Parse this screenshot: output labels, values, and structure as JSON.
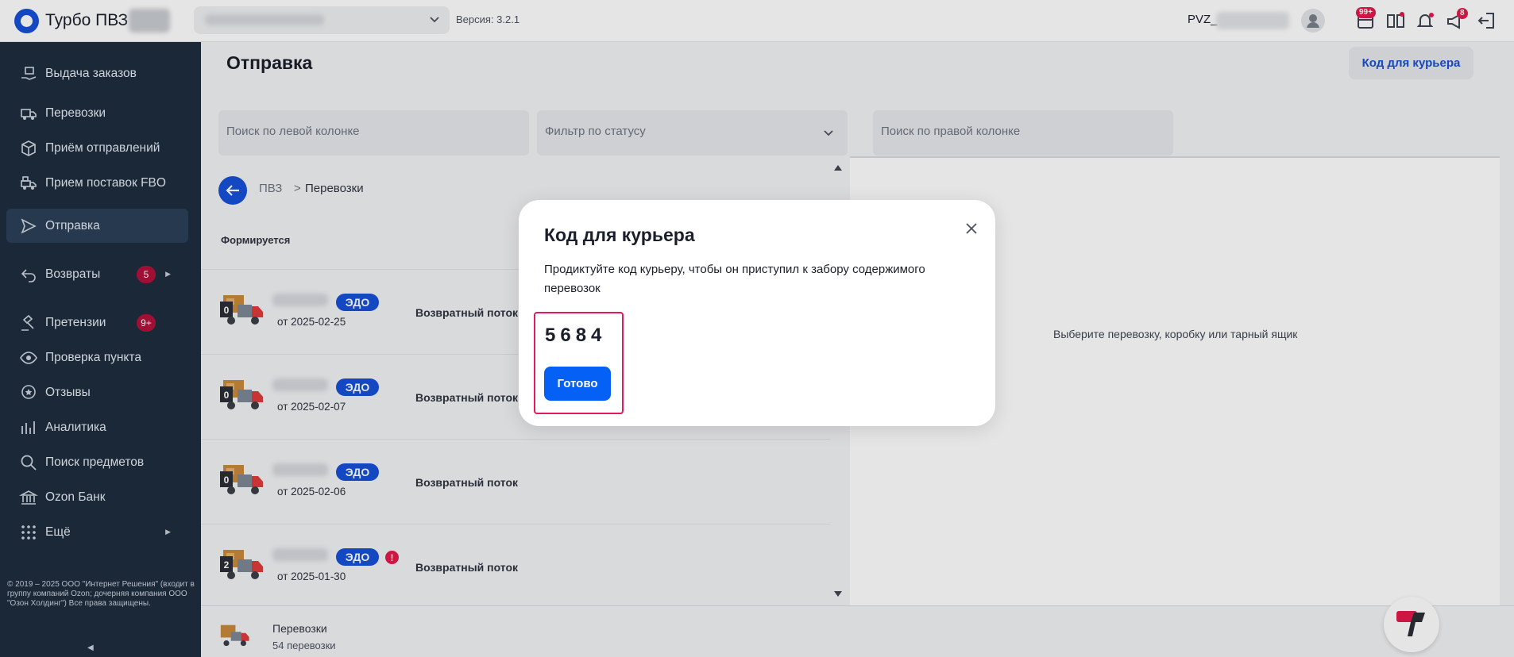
{
  "header": {
    "app_title": "Турбо ПВЗ",
    "version": "Версия: 3.2.1",
    "pvz_prefix": "PVZ_",
    "badges": {
      "box_count": "99+",
      "shop_count": "8"
    }
  },
  "sidebar": {
    "items": [
      {
        "label": "Выдача заказов",
        "icon": "hand-box-icon"
      },
      {
        "label": "Перевозки",
        "icon": "truck-icon"
      },
      {
        "label": "Приём отправлений",
        "icon": "package-icon"
      },
      {
        "label": "Прием поставок FBO",
        "icon": "truck-boxes-icon"
      },
      {
        "label": "Отправка",
        "icon": "send-icon",
        "active": true
      },
      {
        "label": "Возвраты",
        "icon": "return-icon",
        "count": "5",
        "has_arrow": true
      },
      {
        "label": "Претензии",
        "icon": "gavel-icon",
        "count": "9+"
      },
      {
        "label": "Проверка пункта",
        "icon": "eye-icon"
      },
      {
        "label": "Отзывы",
        "icon": "chat-star-icon"
      },
      {
        "label": "Аналитика",
        "icon": "chart-icon"
      },
      {
        "label": "Поиск предметов",
        "icon": "search-icon"
      },
      {
        "label": "Ozon Банк",
        "icon": "bank-icon"
      },
      {
        "label": "Ещё",
        "icon": "grid-icon",
        "has_arrow": true
      }
    ],
    "copyright": "© 2019 – 2025 ООО \"Интернет Решения\" (входит в группу компаний Ozon; дочерняя компания ООО \"Озон Холдинг\") Все права защищены."
  },
  "main": {
    "title": "Отправка",
    "courier_code_button": "Код для курьера",
    "search_left_placeholder": "Поиск по левой колонке",
    "status_filter_placeholder": "Фильтр по статусу",
    "search_right_placeholder": "Поиск по правой колонке",
    "breadcrumb": {
      "root": "ПВЗ",
      "separator": ">",
      "current": "Перевозки"
    },
    "section_label": "Формируется",
    "rows": [
      {
        "truck_count": "0",
        "badge": "ЭДО",
        "date": "от 2025-02-25",
        "flow": "Возвратный поток",
        "warning": false
      },
      {
        "truck_count": "0",
        "badge": "ЭДО",
        "date": "от 2025-02-07",
        "flow": "Возвратный поток",
        "warning": false
      },
      {
        "truck_count": "0",
        "badge": "ЭДО",
        "date": "от 2025-02-06",
        "flow": "Возвратный поток",
        "warning": false
      },
      {
        "truck_count": "2",
        "badge": "ЭДО",
        "date": "от 2025-01-30",
        "flow": "Возвратный поток",
        "warning": true,
        "warning_mark": "!"
      }
    ],
    "right_empty_hint": "Выберите перевозку, коробку или тарный ящик",
    "footer": {
      "title": "Перевозки",
      "count": "54 перевозки"
    }
  },
  "modal": {
    "title": "Код для курьера",
    "text": "Продиктуйте код курьеру, чтобы он приступил к забору содержимого перевозок",
    "code": "5684",
    "done_button": "Готово"
  },
  "colors": {
    "brand_blue": "#1750d9",
    "sidebar_bg": "#1e2d3f",
    "accent_red": "#e5194b",
    "highlight_pink": "#e5195f"
  }
}
